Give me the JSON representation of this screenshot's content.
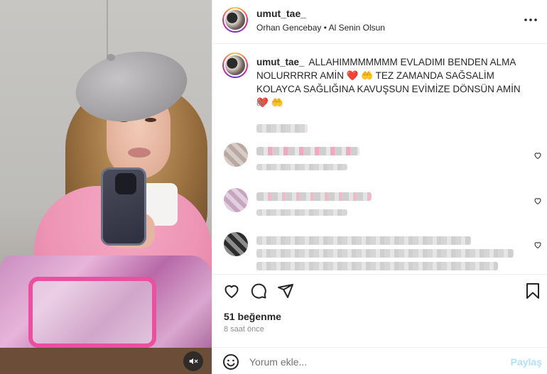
{
  "header": {
    "username": "umut_tae_",
    "audio": "Orhan Gencebay • Al Senin Olsun",
    "more_icon": "more-horizontal-icon"
  },
  "caption": {
    "username": "umut_tae_",
    "text": "ALLAHIMMMMMMM EVLADIMI BENDEN ALMA NOLURRRRR AMİN ❤️ 🤲 TEZ ZAMANDA SAĞSALİM KOLAYCA SAĞLIĞINA KAVUŞSUN EVİMİZE DÖNSÜN AMİN ❤️ 🤲",
    "time": "8s"
  },
  "actions": {
    "icons": [
      "heart-icon",
      "comment-icon",
      "share-icon",
      "bookmark-icon"
    ],
    "likes": "51 beğenme",
    "time_ago": "8 saat önce"
  },
  "comment_box": {
    "placeholder": "Yorum ekle...",
    "post_label": "Paylaş"
  },
  "media": {
    "mute_icon": "muted-speaker-icon"
  },
  "colors": {
    "accent_link": "#b2dffc",
    "heart_emoji": "#e0245e",
    "text": "#262626",
    "muted": "#8e8e8e"
  }
}
